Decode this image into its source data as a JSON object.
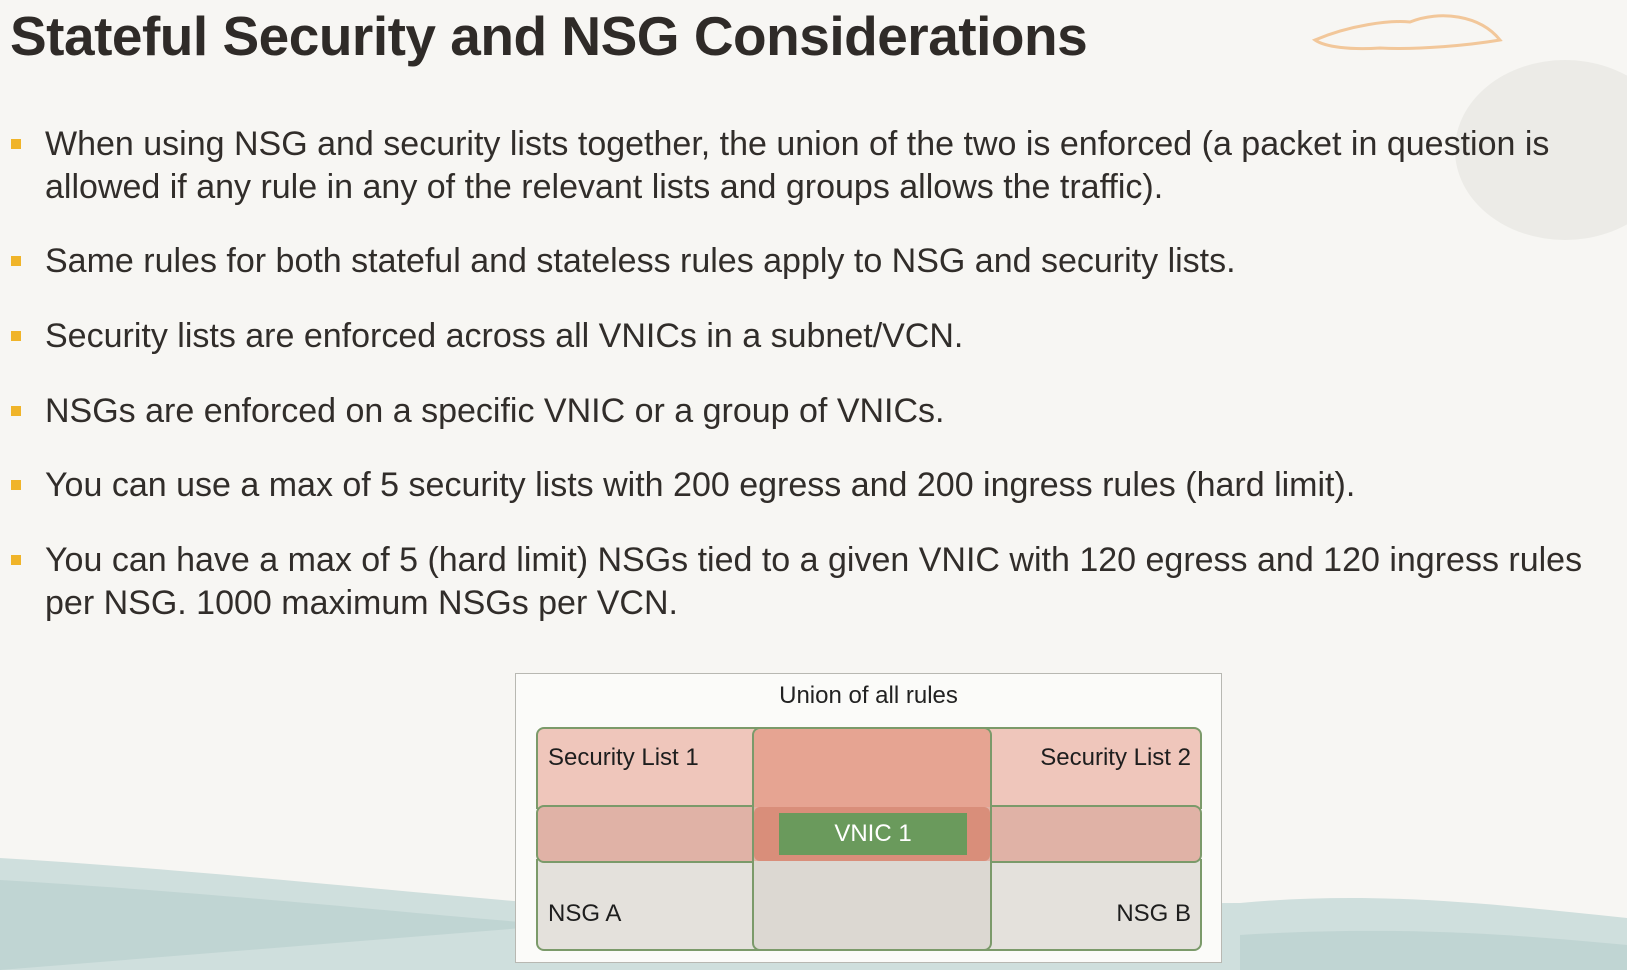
{
  "slide": {
    "title": "Stateful Security and NSG Considerations"
  },
  "bullets": [
    {
      "text": "When using NSG and security lists together, the union of the two is enforced (a packet in question is allowed if any rule in any of the relevant lists and groups allows the traffic)."
    },
    {
      "text": "Same rules for both stateful and stateless rules apply to NSG and security lists."
    },
    {
      "text": "Security lists are enforced across all VNICs in a subnet/VCN."
    },
    {
      "text": "NSGs are enforced on a specific VNIC or a group of VNICs."
    },
    {
      "text": "You can use a max of 5 security lists with 200 egress and 200 ingress rules (hard limit)."
    },
    {
      "text": "You can have a max of 5 (hard limit) NSGs tied to a given VNIC with 120 egress and 120 ingress rules per NSG. 1000 maximum NSGs per VCN."
    }
  ],
  "diagram": {
    "title": "Union of all rules",
    "security_list_1": "Security List 1",
    "security_list_2": "Security List 2",
    "vnic": "VNIC  1",
    "nsg_a": "NSG A",
    "nsg_b": "NSG B"
  },
  "colors": {
    "bullet_marker": "#f0b429",
    "security_list_fill": "#efc6bb",
    "vnic_fill": "#6a9a5c",
    "nsg_fill": "#e4e1dc",
    "outline": "#7b9a6a"
  }
}
